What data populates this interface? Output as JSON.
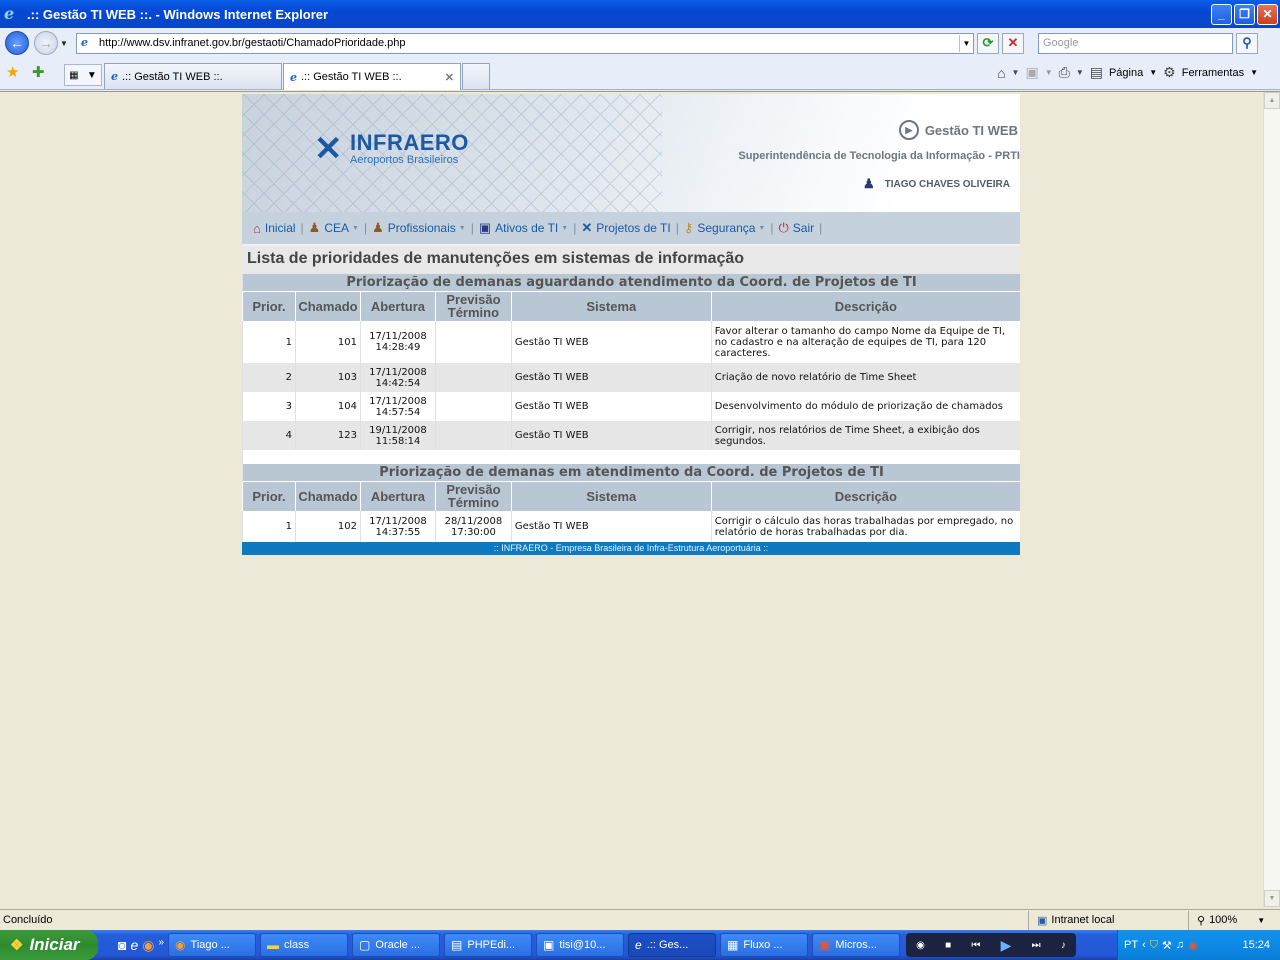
{
  "window": {
    "title": ".:: Gestão TI WEB ::. - Windows Internet Explorer"
  },
  "address": {
    "url": "http://www.dsv.infranet.gov.br/gestaoti/ChamadoPrioridade.php",
    "search_placeholder": "Google"
  },
  "tabs": [
    {
      "label": ".:: Gestão TI WEB ::."
    },
    {
      "label": ".:: Gestão TI WEB ::."
    }
  ],
  "commands": {
    "page": "Página",
    "tools": "Ferramentas"
  },
  "header": {
    "brand": "INFRAERO",
    "brand_sub": "Aeroportos Brasileiros",
    "app_name": "Gestão TI WEB",
    "org": "Superintendência de Tecnologia da Informação - PRTI",
    "user": "TIAGO CHAVES OLIVEIRA"
  },
  "menu": [
    "Inicial",
    "CEA",
    "Profissionais",
    "Ativos de TI",
    "Projetos de TI",
    "Segurança",
    "Sair"
  ],
  "page_title": "Lista de prioridades de manutenções em sistemas de informação",
  "columns": {
    "prior": "Prior.",
    "chamado": "Chamado",
    "abertura": "Abertura",
    "previsao1": "Previsão",
    "previsao2": "Término",
    "sistema": "Sistema",
    "descricao": "Descrição"
  },
  "section1": {
    "title": "Priorização de demanas aguardando atendimento da Coord. de Projetos de TI",
    "rows": [
      {
        "prior": "1",
        "chamado": "101",
        "abertura_d": "17/11/2008",
        "abertura_t": "14:28:49",
        "prev_d": "",
        "prev_t": "",
        "sistema": "Gestão TI WEB",
        "descricao": "Favor alterar o tamanho do campo Nome da Equipe de TI, no cadastro e na alteração de equipes de TI, para 120 caracteres."
      },
      {
        "prior": "2",
        "chamado": "103",
        "abertura_d": "17/11/2008",
        "abertura_t": "14:42:54",
        "prev_d": "",
        "prev_t": "",
        "sistema": "Gestão TI WEB",
        "descricao": "Criação de novo relatório de Time Sheet"
      },
      {
        "prior": "3",
        "chamado": "104",
        "abertura_d": "17/11/2008",
        "abertura_t": "14:57:54",
        "prev_d": "",
        "prev_t": "",
        "sistema": "Gestão TI WEB",
        "descricao": "Desenvolvimento do módulo de priorização de chamados"
      },
      {
        "prior": "4",
        "chamado": "123",
        "abertura_d": "19/11/2008",
        "abertura_t": "11:58:14",
        "prev_d": "",
        "prev_t": "",
        "sistema": "Gestão TI WEB",
        "descricao": "Corrigir, nos relatórios de Time Sheet, a exibição dos segundos."
      }
    ]
  },
  "section2": {
    "title": "Priorização de demanas em atendimento da Coord. de Projetos de TI",
    "rows": [
      {
        "prior": "1",
        "chamado": "102",
        "abertura_d": "17/11/2008",
        "abertura_t": "14:37:55",
        "prev_d": "28/11/2008",
        "prev_t": "17:30:00",
        "sistema": "Gestão TI WEB",
        "descricao": "Corrigir o cálculo das horas trabalhadas por empregado, no relatório de horas trabalhadas por dia."
      }
    ]
  },
  "footer": ":: INFRAERO - Empresa Brasileira de Infra-Estrutura Aeroportuária ::",
  "status": {
    "text": "Concluído",
    "zone": "Intranet local",
    "zoom": "100%"
  },
  "taskbar": {
    "start": "Iniciar",
    "buttons": [
      "Tiago ...",
      "class",
      "Oracle ...",
      "PHPEdi...",
      "tisi@10...",
      ".:: Ges...",
      "Fluxo ...",
      "Micros..."
    ],
    "lang": "PT",
    "clock": "15:24"
  }
}
